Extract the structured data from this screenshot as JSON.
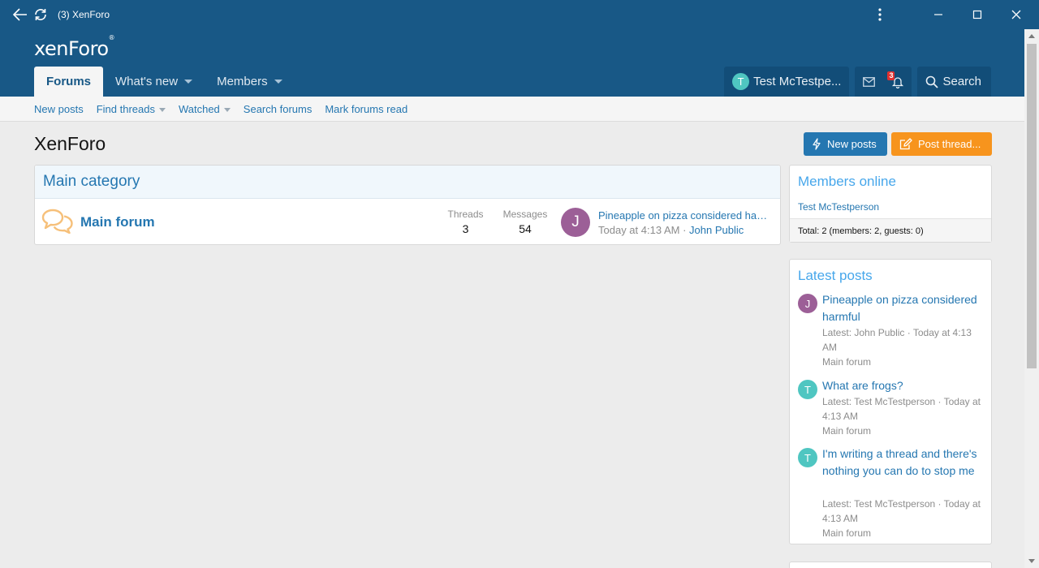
{
  "window": {
    "title": "(3) XenForo",
    "icons": {
      "back": "arrow-left-icon",
      "refresh": "refresh-icon",
      "menu": "kebab-menu-icon",
      "minimize": "minimize-icon",
      "maximize": "maximize-icon",
      "close": "close-icon"
    }
  },
  "header": {
    "logo_text": "xenForo",
    "logo_mark": "®",
    "nav": [
      {
        "label": "Forums",
        "active": true
      },
      {
        "label": "What's new",
        "dropdown": true
      },
      {
        "label": "Members",
        "dropdown": true
      }
    ],
    "user": {
      "avatar_letter": "T",
      "name": "Test McTestpe..."
    },
    "alerts_count": "3",
    "search_label": "Search"
  },
  "subnav": {
    "items": [
      "New posts",
      "Find threads",
      "Watched",
      "Search forums",
      "Mark forums read"
    ]
  },
  "main": {
    "page_title": "XenForo",
    "new_posts_button": "New posts",
    "post_thread_button": "Post thread...",
    "category": {
      "title": "Main category",
      "forum": {
        "title": "Main forum",
        "threads_label": "Threads",
        "threads_value": "3",
        "messages_label": "Messages",
        "messages_value": "54",
        "last_post": {
          "avatar_letter": "J",
          "title": "Pineapple on pizza considered harmful",
          "time": "Today at 4:13 AM",
          "separator": " · ",
          "author": "John Public"
        }
      }
    }
  },
  "sidebar": {
    "members_online": {
      "title": "Members online",
      "user": "Test McTestperson",
      "total": "Total: 2 (members: 2, guests: 0)"
    },
    "latest_posts": {
      "title": "Latest posts",
      "items": [
        {
          "avatar_letter": "J",
          "title": "Pineapple on pizza considered harmful",
          "meta": "Latest: John Public · Today at 4:13 AM",
          "forum": "Main forum"
        },
        {
          "avatar_letter": "T",
          "title": "What are frogs?",
          "meta": "Latest: Test McTestperson · Today at 4:13 AM",
          "forum": "Main forum"
        },
        {
          "avatar_letter": "T",
          "title": "I'm writing a thread and there's nothing you can do to stop me",
          "meta": "Latest: Test McTestperson · Today at 4:13 AM",
          "forum": "Main forum"
        }
      ]
    }
  },
  "colors": {
    "header": "#185886",
    "link": "#2577b1",
    "accent_orange": "#f7941d",
    "sidebar_heading": "#47a7eb"
  }
}
